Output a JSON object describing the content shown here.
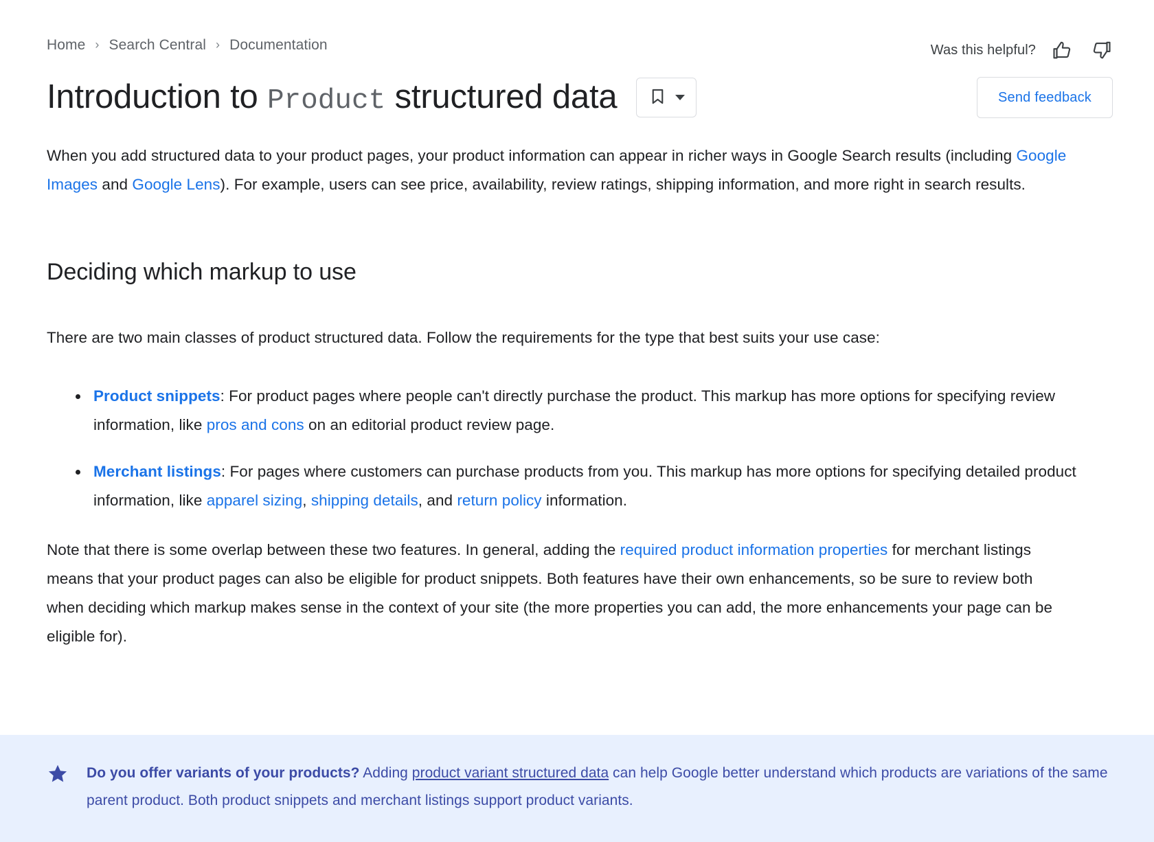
{
  "breadcrumb": {
    "items": [
      {
        "label": "Home"
      },
      {
        "label": "Search Central"
      },
      {
        "label": "Documentation"
      }
    ],
    "separator": "›"
  },
  "helpful": {
    "label": "Was this helpful?",
    "thumb_up_icon": "thumb-up-icon",
    "thumb_down_icon": "thumb-down-icon"
  },
  "header": {
    "title_before": "Introduction to ",
    "title_code": "Product",
    "title_after": " structured data",
    "bookmark_icon": "bookmark-icon",
    "bookmark_caret_icon": "chevron-down-icon",
    "send_feedback_label": "Send feedback"
  },
  "intro": {
    "p1_a": "When you add structured data to your product pages, your product information can appear in richer ways in Google Search results (including ",
    "link_google_images": "Google Images",
    "p1_b": " and ",
    "link_google_lens": "Google Lens",
    "p1_c": "). For example, users can see price, availability, review ratings, shipping information, and more right in search results."
  },
  "section": {
    "heading": "Deciding which markup to use",
    "lead": "There are two main classes of product structured data. Follow the requirements for the type that best suits your use case:",
    "bullets": [
      {
        "link": "Product snippets",
        "text_a": ": For product pages where people can't directly purchase the product. This markup has more options for specifying review information, like ",
        "inline_link": "pros and cons",
        "text_b": " on an editorial product review page."
      },
      {
        "link": "Merchant listings",
        "text_a": ": For pages where customers can purchase products from you. This markup has more options for specifying detailed product information, like ",
        "inline_link_1": "apparel sizing",
        "text_mid_1": ", ",
        "inline_link_2": "shipping details",
        "text_mid_2": ", and ",
        "inline_link_3": "return policy",
        "text_b": " information."
      }
    ],
    "note_a": "Note that there is some overlap between these two features. In general, adding the ",
    "note_link": "required product information properties",
    "note_b": " for merchant listings means that your product pages can also be eligible for product snippets. Both features have their own enhancements, so be sure to review both when deciding which markup makes sense in the context of your site (the more properties you can add, the more enhancements your page can be eligible for)."
  },
  "callout": {
    "icon": "star-icon",
    "bold_lead": "Do you offer variants of your products?",
    "text_a": " Adding ",
    "link": "product variant structured data",
    "text_b": " can help Google better understand which products are variations of the same parent product. Both product snippets and merchant listings support product variants.",
    "background_color": "#e8f0fe",
    "text_color": "#3c4ba6"
  },
  "theme": {
    "link_color": "#1a73e8",
    "text_color": "#202124",
    "muted_color": "#5f6368",
    "border_color": "#dadce0"
  }
}
